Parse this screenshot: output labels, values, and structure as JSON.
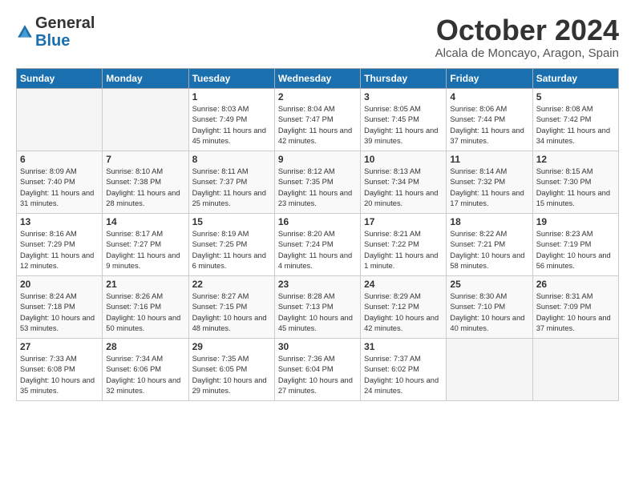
{
  "header": {
    "logo_line1": "General",
    "logo_line2": "Blue",
    "month": "October 2024",
    "location": "Alcala de Moncayo, Aragon, Spain"
  },
  "days_of_week": [
    "Sunday",
    "Monday",
    "Tuesday",
    "Wednesday",
    "Thursday",
    "Friday",
    "Saturday"
  ],
  "weeks": [
    [
      {
        "day": "",
        "info": ""
      },
      {
        "day": "",
        "info": ""
      },
      {
        "day": "1",
        "info": "Sunrise: 8:03 AM\nSunset: 7:49 PM\nDaylight: 11 hours and 45 minutes."
      },
      {
        "day": "2",
        "info": "Sunrise: 8:04 AM\nSunset: 7:47 PM\nDaylight: 11 hours and 42 minutes."
      },
      {
        "day": "3",
        "info": "Sunrise: 8:05 AM\nSunset: 7:45 PM\nDaylight: 11 hours and 39 minutes."
      },
      {
        "day": "4",
        "info": "Sunrise: 8:06 AM\nSunset: 7:44 PM\nDaylight: 11 hours and 37 minutes."
      },
      {
        "day": "5",
        "info": "Sunrise: 8:08 AM\nSunset: 7:42 PM\nDaylight: 11 hours and 34 minutes."
      }
    ],
    [
      {
        "day": "6",
        "info": "Sunrise: 8:09 AM\nSunset: 7:40 PM\nDaylight: 11 hours and 31 minutes."
      },
      {
        "day": "7",
        "info": "Sunrise: 8:10 AM\nSunset: 7:38 PM\nDaylight: 11 hours and 28 minutes."
      },
      {
        "day": "8",
        "info": "Sunrise: 8:11 AM\nSunset: 7:37 PM\nDaylight: 11 hours and 25 minutes."
      },
      {
        "day": "9",
        "info": "Sunrise: 8:12 AM\nSunset: 7:35 PM\nDaylight: 11 hours and 23 minutes."
      },
      {
        "day": "10",
        "info": "Sunrise: 8:13 AM\nSunset: 7:34 PM\nDaylight: 11 hours and 20 minutes."
      },
      {
        "day": "11",
        "info": "Sunrise: 8:14 AM\nSunset: 7:32 PM\nDaylight: 11 hours and 17 minutes."
      },
      {
        "day": "12",
        "info": "Sunrise: 8:15 AM\nSunset: 7:30 PM\nDaylight: 11 hours and 15 minutes."
      }
    ],
    [
      {
        "day": "13",
        "info": "Sunrise: 8:16 AM\nSunset: 7:29 PM\nDaylight: 11 hours and 12 minutes."
      },
      {
        "day": "14",
        "info": "Sunrise: 8:17 AM\nSunset: 7:27 PM\nDaylight: 11 hours and 9 minutes."
      },
      {
        "day": "15",
        "info": "Sunrise: 8:19 AM\nSunset: 7:25 PM\nDaylight: 11 hours and 6 minutes."
      },
      {
        "day": "16",
        "info": "Sunrise: 8:20 AM\nSunset: 7:24 PM\nDaylight: 11 hours and 4 minutes."
      },
      {
        "day": "17",
        "info": "Sunrise: 8:21 AM\nSunset: 7:22 PM\nDaylight: 11 hours and 1 minute."
      },
      {
        "day": "18",
        "info": "Sunrise: 8:22 AM\nSunset: 7:21 PM\nDaylight: 10 hours and 58 minutes."
      },
      {
        "day": "19",
        "info": "Sunrise: 8:23 AM\nSunset: 7:19 PM\nDaylight: 10 hours and 56 minutes."
      }
    ],
    [
      {
        "day": "20",
        "info": "Sunrise: 8:24 AM\nSunset: 7:18 PM\nDaylight: 10 hours and 53 minutes."
      },
      {
        "day": "21",
        "info": "Sunrise: 8:26 AM\nSunset: 7:16 PM\nDaylight: 10 hours and 50 minutes."
      },
      {
        "day": "22",
        "info": "Sunrise: 8:27 AM\nSunset: 7:15 PM\nDaylight: 10 hours and 48 minutes."
      },
      {
        "day": "23",
        "info": "Sunrise: 8:28 AM\nSunset: 7:13 PM\nDaylight: 10 hours and 45 minutes."
      },
      {
        "day": "24",
        "info": "Sunrise: 8:29 AM\nSunset: 7:12 PM\nDaylight: 10 hours and 42 minutes."
      },
      {
        "day": "25",
        "info": "Sunrise: 8:30 AM\nSunset: 7:10 PM\nDaylight: 10 hours and 40 minutes."
      },
      {
        "day": "26",
        "info": "Sunrise: 8:31 AM\nSunset: 7:09 PM\nDaylight: 10 hours and 37 minutes."
      }
    ],
    [
      {
        "day": "27",
        "info": "Sunrise: 7:33 AM\nSunset: 6:08 PM\nDaylight: 10 hours and 35 minutes."
      },
      {
        "day": "28",
        "info": "Sunrise: 7:34 AM\nSunset: 6:06 PM\nDaylight: 10 hours and 32 minutes."
      },
      {
        "day": "29",
        "info": "Sunrise: 7:35 AM\nSunset: 6:05 PM\nDaylight: 10 hours and 29 minutes."
      },
      {
        "day": "30",
        "info": "Sunrise: 7:36 AM\nSunset: 6:04 PM\nDaylight: 10 hours and 27 minutes."
      },
      {
        "day": "31",
        "info": "Sunrise: 7:37 AM\nSunset: 6:02 PM\nDaylight: 10 hours and 24 minutes."
      },
      {
        "day": "",
        "info": ""
      },
      {
        "day": "",
        "info": ""
      }
    ]
  ]
}
